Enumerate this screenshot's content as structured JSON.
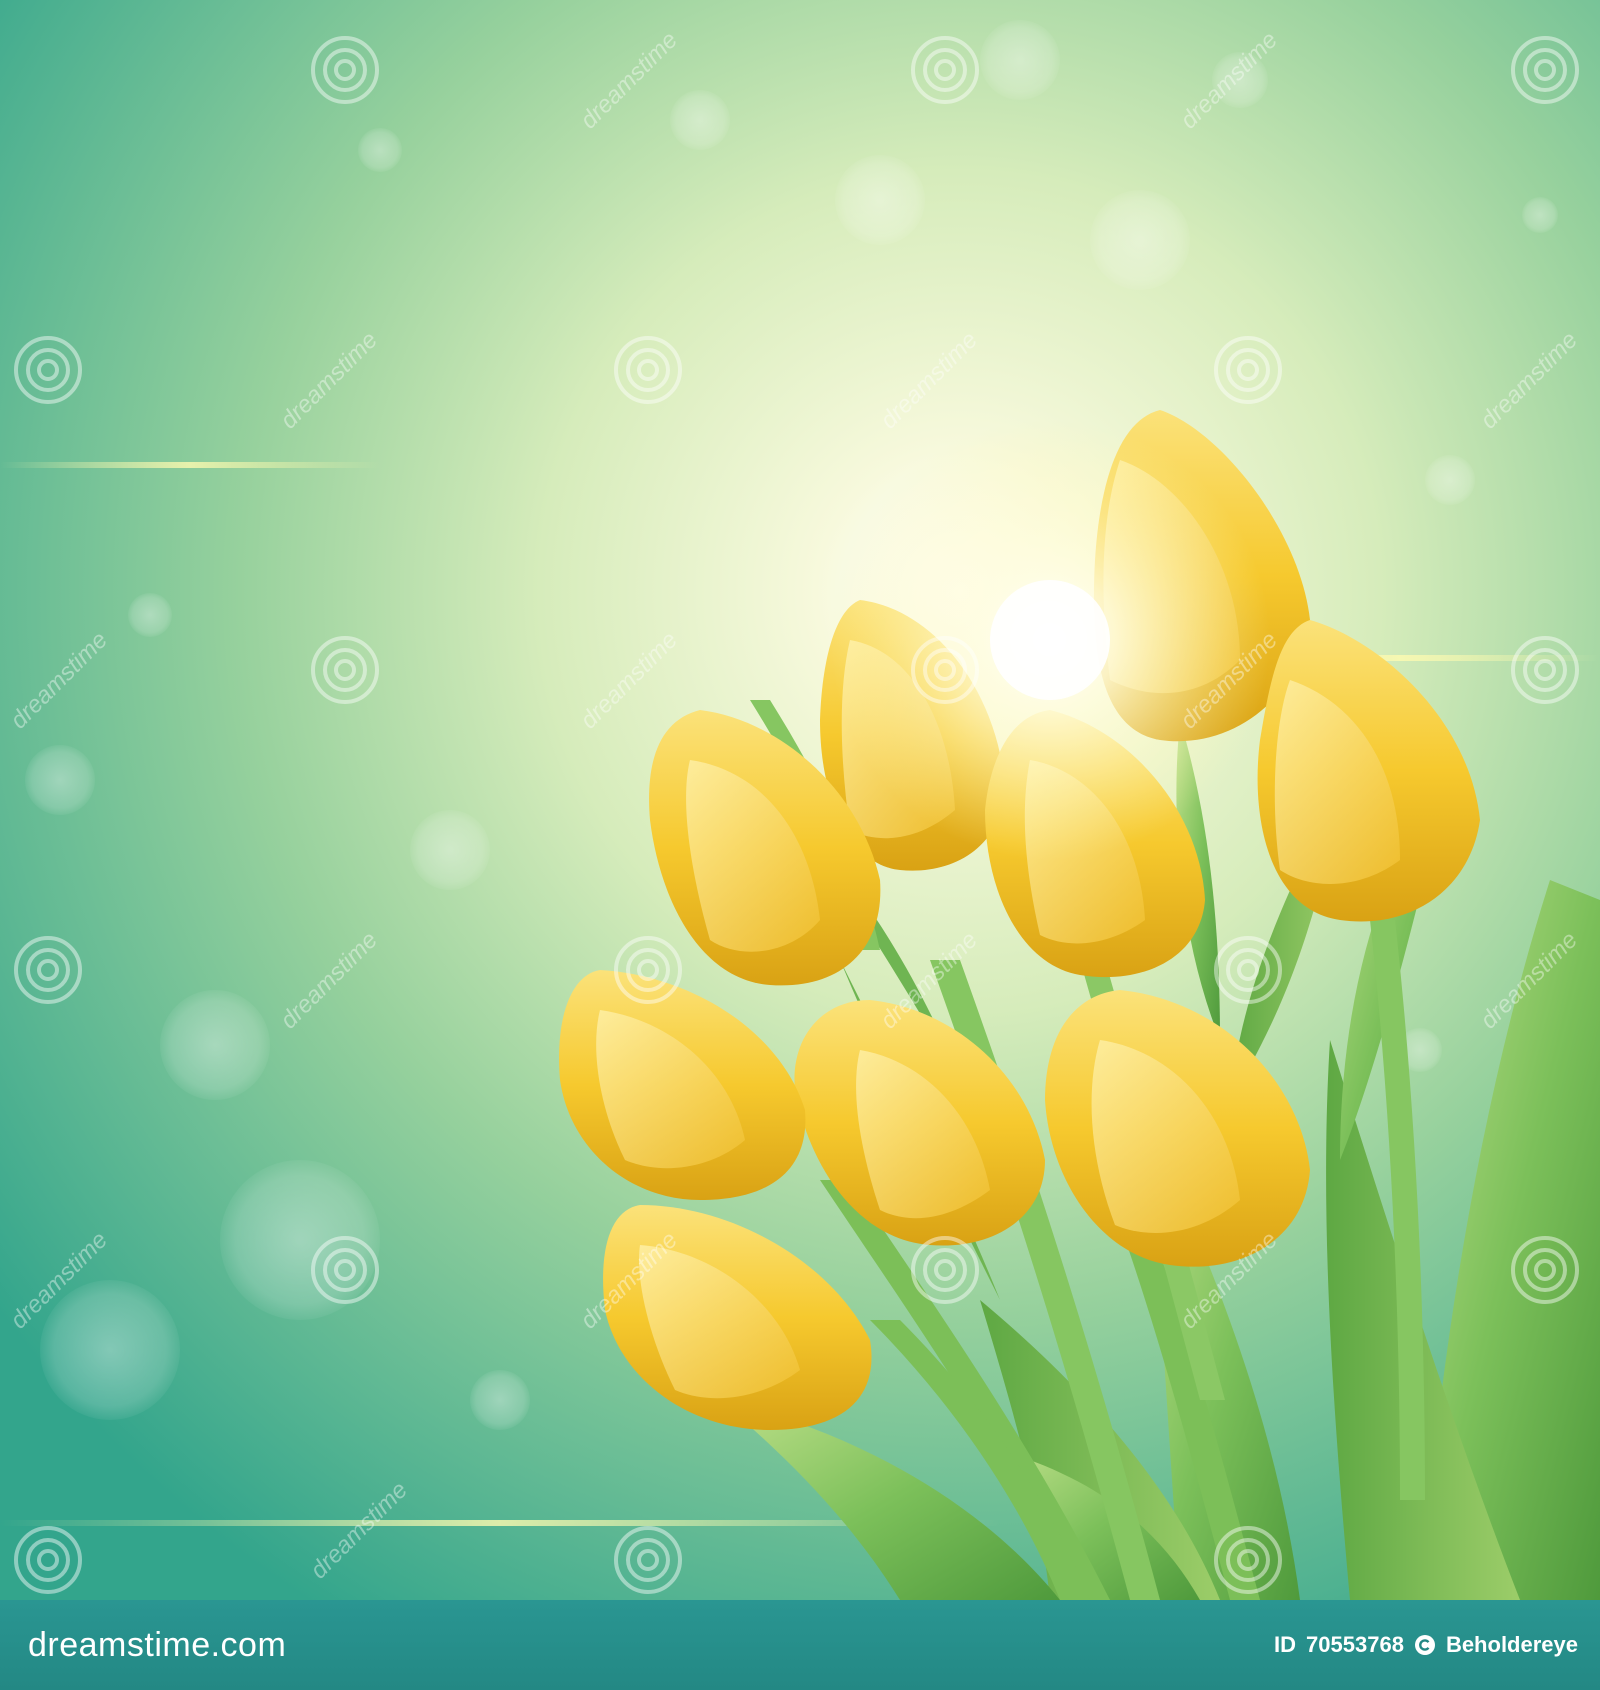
{
  "image": {
    "subject": "yellow-tulip-bouquet",
    "background_colors": [
      "#2f9e8c",
      "#9fd49a",
      "#f6f8d6"
    ],
    "flower_color": "#f7c52a",
    "leaf_color": "#7cc05a"
  },
  "watermark": {
    "icon": "swirl-icon",
    "text": "dreamstime"
  },
  "footer": {
    "logo_text": "dreamstime.com",
    "id_prefix": "ID",
    "id_number": "70553768",
    "cc_icon": "copyright-icon",
    "author": "Beholdereye"
  }
}
